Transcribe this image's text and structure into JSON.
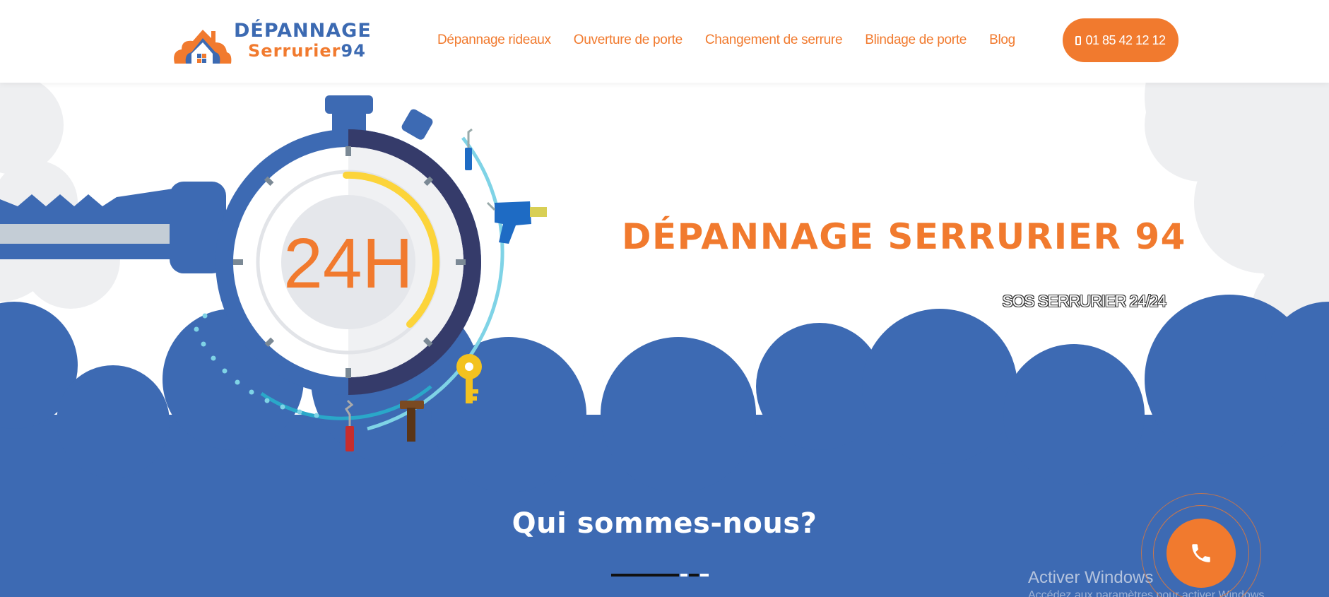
{
  "brand": {
    "line1": "DÉPANNAGE",
    "line2_text": "Serrurier",
    "line2_num": "94",
    "colors": {
      "orange": "#f17a2e",
      "blue": "#3c6ab2",
      "dark_navy": "#353b6a"
    }
  },
  "nav": {
    "items": [
      {
        "label": "Dépannage rideaux"
      },
      {
        "label": "Ouverture de porte"
      },
      {
        "label": "Changement de serrure"
      },
      {
        "label": "Blindage de porte"
      },
      {
        "label": "Blog"
      }
    ]
  },
  "header": {
    "phone_label": "01 85 42 12 12",
    "phone_icon": "mobile-phone-icon"
  },
  "hero": {
    "title": "DÉPANNAGE SERRURIER 94",
    "subtitle": "SOS SERRURIER 24/24",
    "clock_text": "24H",
    "illustration": "stopwatch-key-tools-illustration"
  },
  "about": {
    "title": "Qui sommes-nous?"
  },
  "floating": {
    "call_icon": "phone-handset-icon"
  },
  "overlay": {
    "watermark": "Activer Windows",
    "watermark2": "Accédez aux paramètres pour activer Windows."
  }
}
